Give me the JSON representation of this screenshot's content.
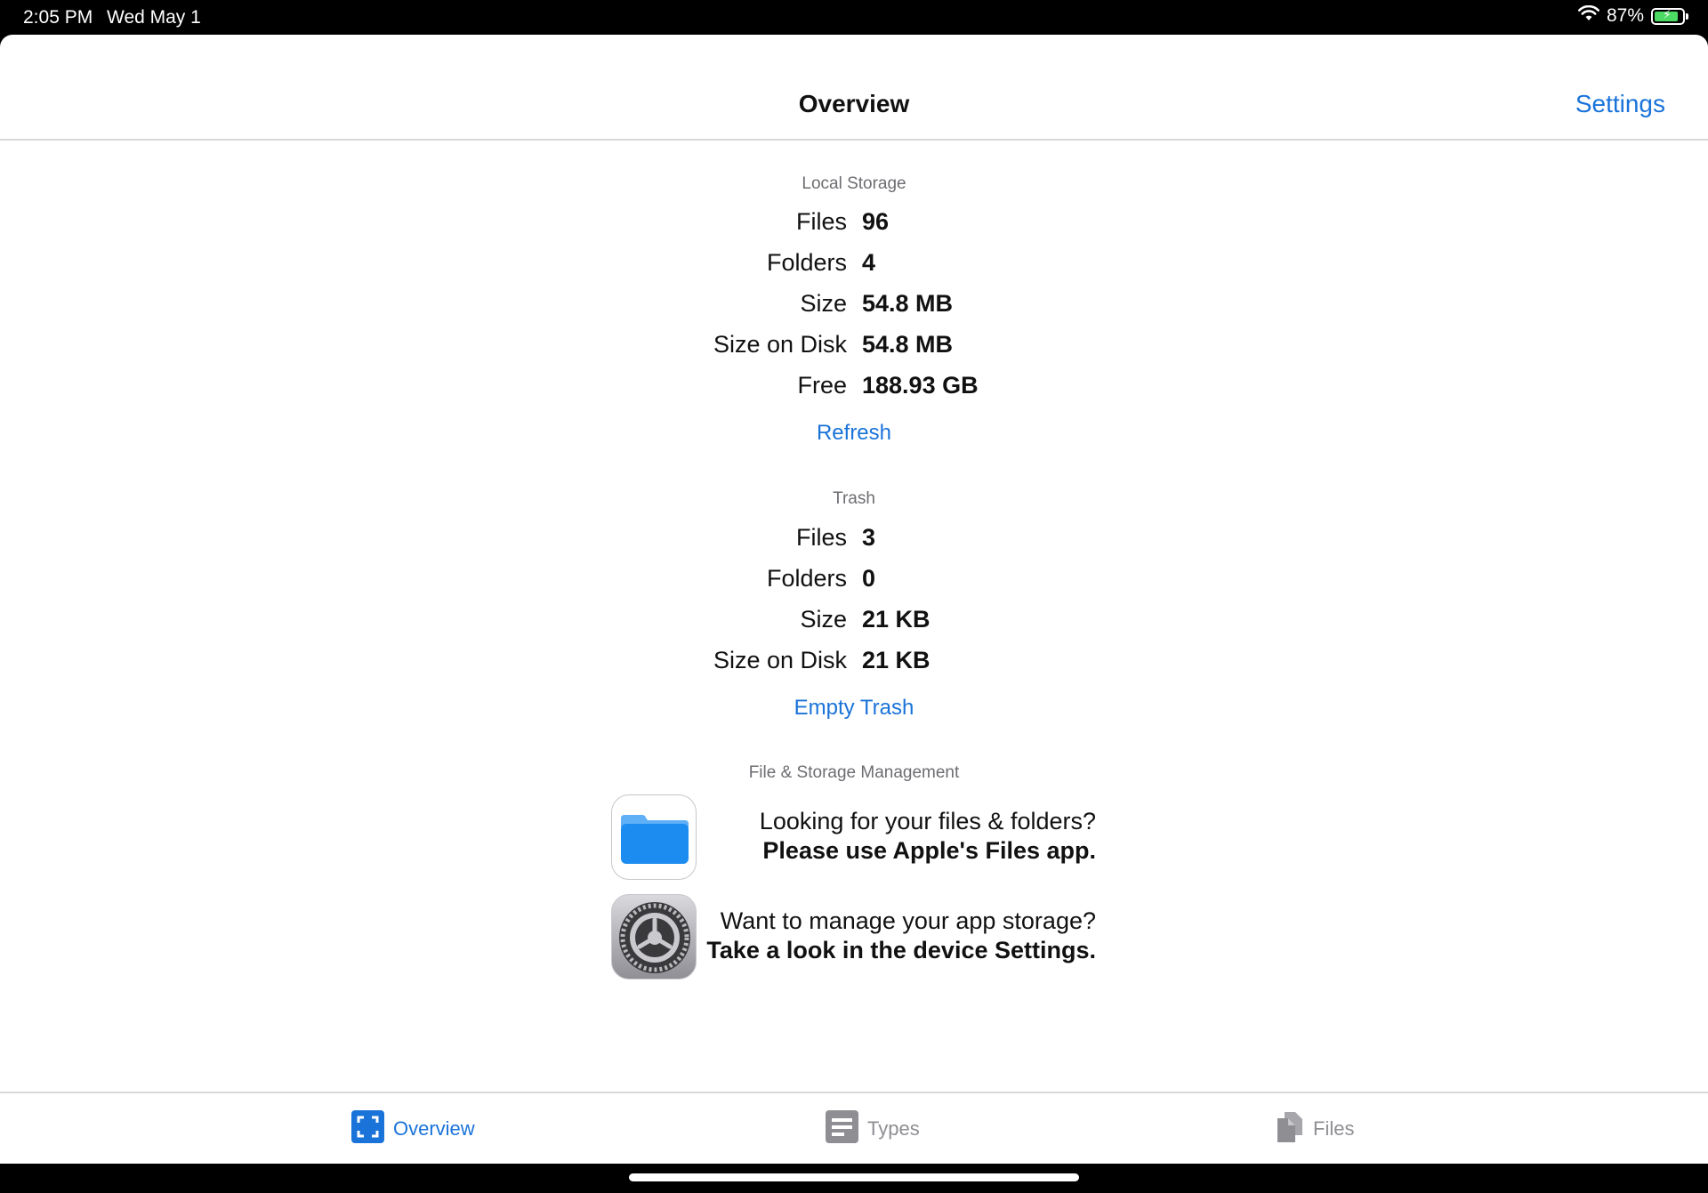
{
  "status_bar": {
    "time": "2:05 PM",
    "date": "Wed May 1",
    "battery": "87%",
    "battery_level": 0.87
  },
  "nav": {
    "title": "Overview",
    "settings_label": "Settings"
  },
  "local_storage": {
    "header": "Local Storage",
    "rows": [
      {
        "label": "Files",
        "value": "96"
      },
      {
        "label": "Folders",
        "value": "4"
      },
      {
        "label": "Size",
        "value": "54.8 MB"
      },
      {
        "label": "Size on Disk",
        "value": "54.8 MB"
      },
      {
        "label": "Free",
        "value": "188.93 GB"
      }
    ],
    "action": "Refresh"
  },
  "trash": {
    "header": "Trash",
    "rows": [
      {
        "label": "Files",
        "value": "3"
      },
      {
        "label": "Folders",
        "value": "0"
      },
      {
        "label": "Size",
        "value": "21 KB"
      },
      {
        "label": "Size on Disk",
        "value": "21 KB"
      }
    ],
    "action": "Empty Trash"
  },
  "management": {
    "header": "File & Storage Management",
    "files_line1": "Looking for your files & folders?",
    "files_line2": "Please use Apple's Files app.",
    "settings_line1": "Want to manage your app storage?",
    "settings_line2": "Take a look in the device Settings."
  },
  "tabs": [
    {
      "label": "Overview",
      "active": true
    },
    {
      "label": "Types",
      "active": false
    },
    {
      "label": "Files",
      "active": false
    }
  ],
  "colors": {
    "accent": "#1a73d9",
    "inactive": "#8e8e93",
    "battery": "#4cd964"
  }
}
